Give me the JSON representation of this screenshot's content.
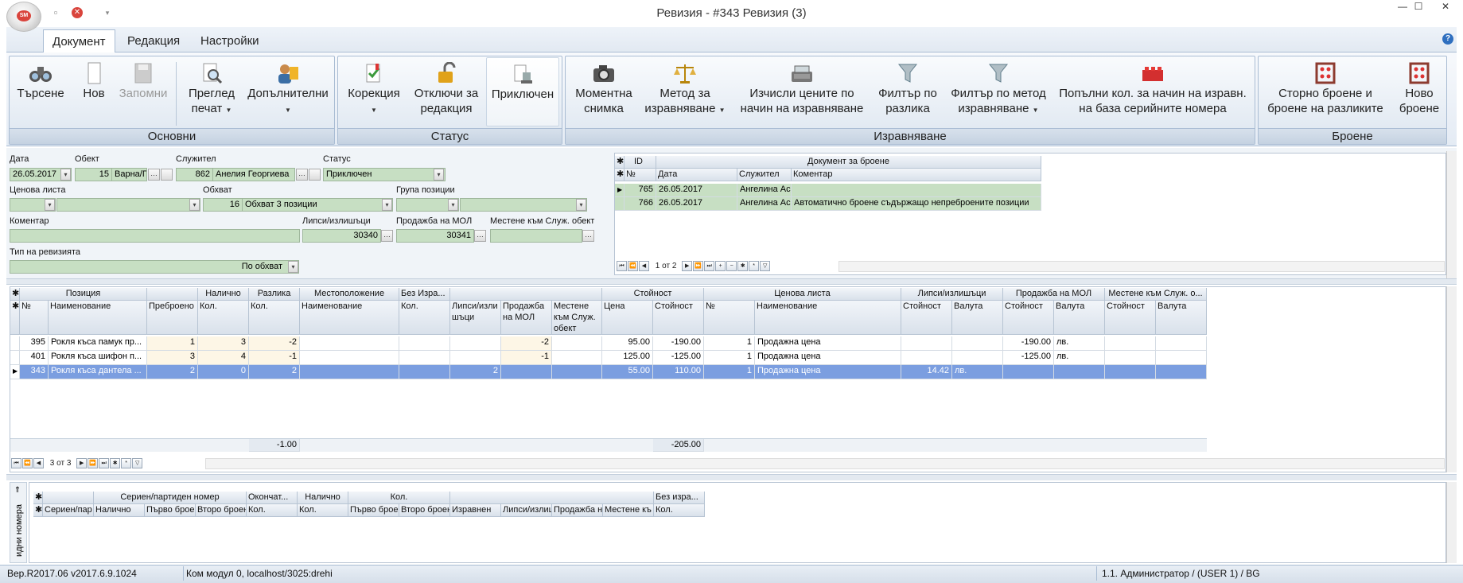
{
  "window": {
    "title": "Ревизия - #343 Ревизия (3)",
    "logo_text": "SM"
  },
  "tabs": [
    {
      "label": "Документ",
      "active": true
    },
    {
      "label": "Редакция",
      "active": false
    },
    {
      "label": "Настройки",
      "active": false
    }
  ],
  "ribbon": {
    "groups": {
      "osnovni": "Основни",
      "status": "Статус",
      "izravnyavane": "Изравняване",
      "broene": "Броене"
    },
    "buttons": {
      "search": "Търсене",
      "new": "Нов",
      "save": "Запомни",
      "preview_1": "Преглед",
      "preview_2": "печат",
      "additional_1": "Допълнителни",
      "correction": "Корекция",
      "unlock_1": "Отключи за",
      "unlock_2": "редакция",
      "closed": "Приключен",
      "snapshot_1": "Моментна",
      "snapshot_2": "снимка",
      "method_1": "Метод за",
      "method_2": "изравняване",
      "calc_1": "Изчисли цените по",
      "calc_2": "начин на изравняване",
      "filter_diff_1": "Филтър по",
      "filter_diff_2": "разлика",
      "filter_method_1": "Филтър по метод",
      "filter_method_2": "изравняване",
      "fill_1": "Попълни кол. за начин на изравн.",
      "fill_2": "на база серийните номера",
      "storno_1": "Сторно броене и",
      "storno_2": "броене на разликите",
      "new_count_1": "Ново",
      "new_count_2": "броене"
    }
  },
  "form": {
    "labels": {
      "date": "Дата",
      "object": "Обект",
      "employee": "Служител",
      "status": "Статус",
      "price_list": "Ценова листа",
      "scope": "Обхват",
      "item_group": "Група позиции",
      "comment": "Коментар",
      "shortage": "Липси/излишъци",
      "sale_mol": "Продажба на МОЛ",
      "move_obj": "Местене към Служ. обект",
      "rev_type": "Тип на ревизията"
    },
    "values": {
      "date": "26.05.2017",
      "object_id": "15",
      "object_name": "Варна/Пр",
      "employee_id": "862",
      "employee_name": "Анелия Георгиева",
      "status": "Приключен",
      "scope_id": "16",
      "scope_name": "Обхват 3 позиции",
      "shortage": "30340",
      "sale_mol": "30341",
      "rev_type": "По обхват"
    }
  },
  "count_docs": {
    "group_header": "Документ за броене",
    "headers": {
      "id": "ID",
      "no": "№",
      "date": "Дата",
      "employee": "Служител",
      "comment": "Коментар"
    },
    "rows": [
      {
        "no": "765",
        "date": "26.05.2017",
        "employee": "Ангелина Ас",
        "comment": ""
      },
      {
        "no": "766",
        "date": "26.05.2017",
        "employee": "Ангелина Ас",
        "comment": "Автоматично броене съдържащо непреброените позиции"
      }
    ],
    "nav": "1 от 2"
  },
  "main_grid": {
    "group_headers": {
      "position": "Позиция",
      "available": "Налично",
      "difference": "Разлика",
      "location": "Местоположение",
      "no_eq": "Без Изра...",
      "value": "Стойност",
      "price_list": "Ценова листа",
      "shortage": "Липси/излишъци",
      "sale_mol": "Продажба на МОЛ",
      "move_obj": "Местене към Служ. о..."
    },
    "headers": {
      "no": "№",
      "name": "Наименование",
      "counted": "Преброено",
      "qty": "Кол.",
      "diff_qty": "Кол.",
      "loc_name": "Наименование",
      "noeq_qty": "Кол.",
      "shortage": "Липси/изли шъци",
      "sale": "Продажба на МОЛ",
      "move": "Местене към Служ. обект",
      "price": "Цена",
      "value": "Стойност",
      "pl_no": "№",
      "pl_name": "Наименование",
      "sh_value": "Стойност",
      "sh_cur": "Валута",
      "sm_value": "Стойност",
      "sm_cur": "Валута",
      "mv_value": "Стойност",
      "mv_cur": "Валута"
    },
    "rows": [
      {
        "no": "395",
        "name": "Рокля къса памук пр...",
        "counted": "1",
        "qty": "3",
        "diff": "-2",
        "shortage": "",
        "sale": "-2",
        "price": "95.00",
        "value": "-190.00",
        "pl_no": "1",
        "pl_name": "Продажна цена",
        "sh_value": "",
        "sh_cur": "",
        "sm_value": "-190.00",
        "sm_cur": "лв."
      },
      {
        "no": "401",
        "name": "Рокля къса шифон п...",
        "counted": "3",
        "qty": "4",
        "diff": "-1",
        "shortage": "",
        "sale": "-1",
        "price": "125.00",
        "value": "-125.00",
        "pl_no": "1",
        "pl_name": "Продажна цена",
        "sh_value": "",
        "sh_cur": "",
        "sm_value": "-125.00",
        "sm_cur": "лв."
      },
      {
        "no": "343",
        "name": "Рокля къса дантела ...",
        "counted": "2",
        "qty": "0",
        "diff": "2",
        "shortage": "2",
        "sale": "",
        "price": "55.00",
        "value": "110.00",
        "pl_no": "1",
        "pl_name": "Продажна цена",
        "sh_value": "14.42",
        "sh_cur": "лв.",
        "sm_value": "",
        "sm_cur": ""
      }
    ],
    "totals": {
      "diff": "-1.00",
      "value": "-205.00"
    },
    "nav": "3 от 3"
  },
  "serial_grid": {
    "side_label": "идни номера",
    "group_headers": {
      "serial": "Сериен/партиден номер",
      "final": "Окончат...",
      "available": "Налично",
      "qty": "Кол.",
      "no_eq": "Без изра..."
    },
    "headers": [
      "Сериен/пар",
      "Налично",
      "Първо брое",
      "Второ броен",
      "Кол.",
      "Кол.",
      "Първо брое",
      "Второ броен",
      "Изравнен",
      "Липси/излиш",
      "Продажба н",
      "Местене къ",
      "Кол."
    ]
  },
  "statusbar": {
    "version": "Вер.R2017.06 v2017.6.9.1024",
    "com": "Ком модул 0, localhost/3025:drehi",
    "user": "1.1. Администратор /  (USER 1) / BG"
  },
  "colors": {
    "accent": "#2f6fbf",
    "selected_row": "#7b9ee0",
    "field_green": "#c7dfc3"
  }
}
